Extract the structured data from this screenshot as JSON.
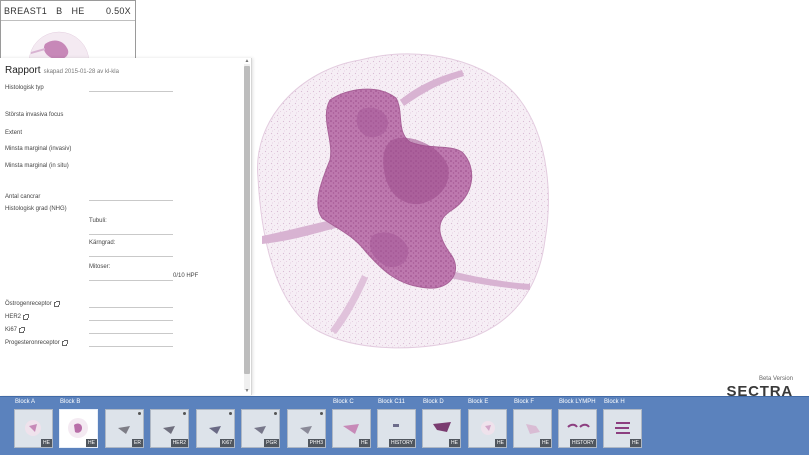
{
  "overview": {
    "case_id": "BREAST1",
    "block": "B",
    "stain": "HE",
    "zoom": "0.50X"
  },
  "report": {
    "title": "Rapport",
    "subtitle": "skapad 2015-01-28 av kl-kla",
    "fields": [
      "Histologisk typ",
      "Största invasiva focus",
      "Extent",
      "Minsta marginal (invasiv)",
      "Minsta marginal (in situ)",
      "Antal cancrar",
      "Histologisk grad (NHG)"
    ],
    "grade_subfields": [
      "Tubuli:",
      "Kärngrad:",
      "Mitoser:"
    ],
    "mitoses_ratio": "0/10 HPF",
    "links": [
      "Östrogenreceptor",
      "HER2",
      "Ki67",
      "Progesteronreceptor"
    ]
  },
  "logo": {
    "beta": "Beta Version",
    "brand": "SECTRA"
  },
  "strip": {
    "blocks": [
      "Block A",
      "Block B",
      "Block C",
      "Block C11",
      "Block D",
      "Block E",
      "Block F",
      "Block LYMPH",
      "Block H"
    ],
    "slides": [
      {
        "stain": "HE",
        "active": false
      },
      {
        "stain": "HE",
        "active": true
      },
      {
        "stain": "ER",
        "active": false
      },
      {
        "stain": "HER2",
        "active": false
      },
      {
        "stain": "Ki67",
        "active": false
      },
      {
        "stain": "PGR",
        "active": false
      },
      {
        "stain": "PHH3",
        "active": false
      },
      {
        "stain": "HE",
        "active": false
      },
      {
        "stain": "HISTORY",
        "active": false
      },
      {
        "stain": "HE",
        "active": false
      },
      {
        "stain": "HE",
        "active": false
      },
      {
        "stain": "HE",
        "active": false
      },
      {
        "stain": "HISTORY",
        "active": false
      },
      {
        "stain": "HE",
        "active": false
      }
    ]
  },
  "colors": {
    "tissue_stroma": "#e8d4e4",
    "tissue_dense": "#b86ea8",
    "tissue_dark": "#9c4d8c",
    "strip_background": "#5b82bd",
    "stain_badge": "#50565e"
  }
}
